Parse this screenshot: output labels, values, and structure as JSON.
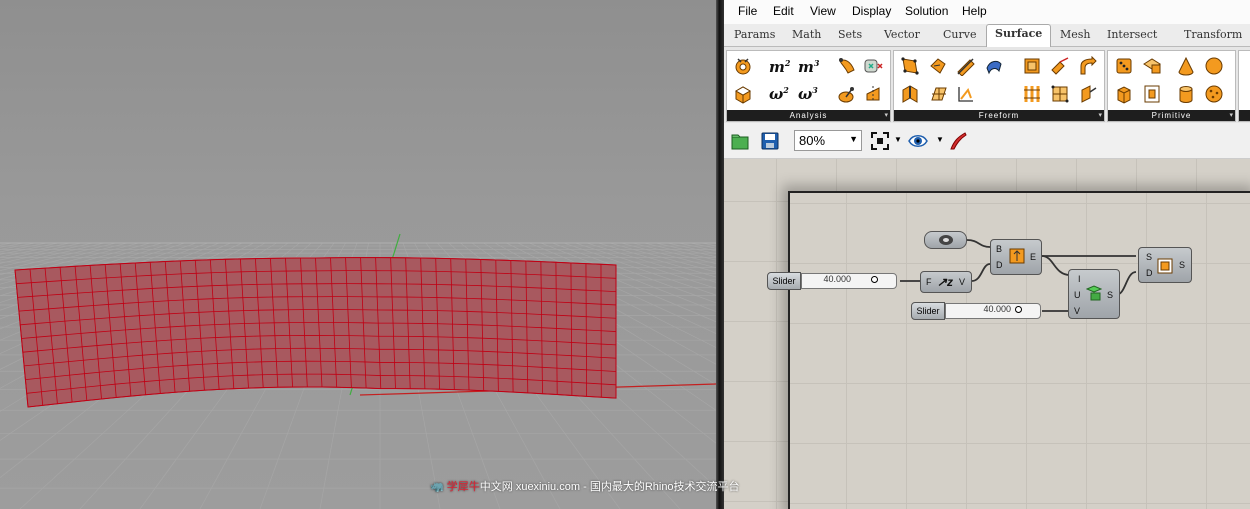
{
  "menu": [
    "File",
    "Edit",
    "View",
    "Display",
    "Solution",
    "Help"
  ],
  "tabs": [
    "Params",
    "Math",
    "Sets",
    "Vector",
    "Curve",
    "Surface",
    "Mesh",
    "Intersect",
    "Transform"
  ],
  "active_tab": "Surface",
  "ribbon_panels": [
    {
      "label": "Analysis",
      "icons": [
        "mass-icon",
        "area-m2-icon",
        "volume-m3-icon",
        "evaluate-icon",
        "box-icon",
        "area-moments-icon",
        "volume-moments-icon",
        "dimensions-icon",
        "surface-point-icon",
        "brep-edges-icon"
      ]
    },
    {
      "label": "Freeform",
      "icons": [
        "fourpoint-surface-icon",
        "boundary-surface-icon",
        "sweep-icon",
        "loft-icon",
        "extrude-icon",
        "pipe-icon",
        "network-surface-icon",
        "surface-from-points-icon",
        "fragment-icon",
        "sum-surface-icon",
        "rail-revolve-icon",
        "extrude-point-icon"
      ]
    },
    {
      "label": "Primitive",
      "icons": [
        "dice-icon",
        "plane-surface-icon",
        "cone-icon",
        "sphere-icon",
        "box-2pt-icon",
        "bounding-box-icon",
        "cylinder-icon",
        "bumpy-sphere-icon"
      ]
    }
  ],
  "toolbar": {
    "zoom": "80%",
    "icons": [
      "open-file-icon",
      "save-file-icon",
      "zoom-extents-icon",
      "preview-eye-icon",
      "sketch-pen-icon"
    ]
  },
  "canvas": {
    "components": [
      {
        "name": "curve-param",
        "inputs": [],
        "outputs": []
      },
      {
        "name": "extrude",
        "inputs": [
          "B",
          "D"
        ],
        "outputs": [
          "E"
        ]
      },
      {
        "name": "unit-z",
        "inputs": [
          "F"
        ],
        "outputs": [
          "V"
        ]
      },
      {
        "name": "divide-surface",
        "inputs": [
          "I",
          "U",
          "V"
        ],
        "outputs": [
          "S"
        ]
      },
      {
        "name": "surface-param",
        "inputs": [
          "S",
          "D"
        ],
        "outputs": [
          "S"
        ]
      }
    ],
    "sliders": [
      {
        "label": "Slider",
        "value": "40.000"
      },
      {
        "label": "Slider",
        "value": "40.000"
      }
    ]
  },
  "watermark": {
    "brand": "学犀牛",
    "site": "中文网 xuexiniu.com",
    "tagline": "- 国内最大的Rhino技术交流平台"
  },
  "colors": {
    "surface_fill": "#a8595f",
    "surface_wire": "#c00014",
    "icon_orange": "#f39a1f",
    "canvas_bg": "#d4d0c8"
  }
}
